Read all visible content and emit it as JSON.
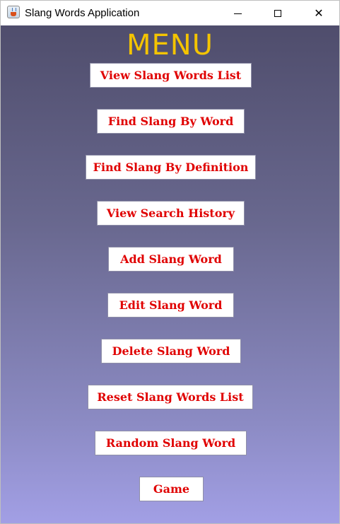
{
  "window": {
    "title": "Slang Words Application",
    "icon": "java-icon",
    "controls": {
      "minimize": "minimize-icon",
      "maximize": "maximize-icon",
      "close": "close-icon"
    }
  },
  "menu": {
    "title": "MENU",
    "buttons": [
      {
        "label": "View Slang Words List"
      },
      {
        "label": "Find Slang By Word"
      },
      {
        "label": "Find Slang By Definition"
      },
      {
        "label": "View Search History"
      },
      {
        "label": "Add Slang Word"
      },
      {
        "label": "Edit Slang Word"
      },
      {
        "label": "Delete Slang Word"
      },
      {
        "label": "Reset Slang Words List"
      },
      {
        "label": "Random Slang Word"
      },
      {
        "label": "Game"
      }
    ]
  },
  "colors": {
    "menu_title": "#f4c400",
    "button_text": "#e00000",
    "background_top": "#4f4d6c",
    "background_bottom": "#a29fe5"
  }
}
